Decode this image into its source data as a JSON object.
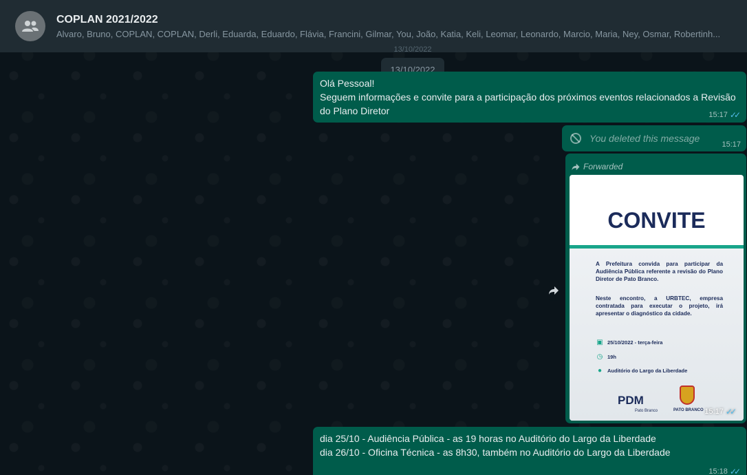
{
  "header": {
    "title": "COPLAN 2021/2022",
    "members": "Alvaro, Bruno, COPLAN, COPLAN, Derli, Eduarda, Eduardo, Flávia, Francini, Gilmar, You, João, Katia, Keli, Leomar, Leonardo, Marcio, Maria, Ney, Osmar, Robertinh..."
  },
  "date_ghost": "13/10/2022",
  "date_chip": "13/10/2022",
  "messages": {
    "m1": {
      "line1": "Olá Pessoal!",
      "line2": "Seguem informações e convite para a participação dos próximos eventos relacionados a Revisão do Plano Diretor",
      "time": "15:17"
    },
    "m2": {
      "text": "You deleted this message",
      "time": "15:17"
    },
    "m3": {
      "forwarded": "Forwarded",
      "time": "15:17",
      "invite": {
        "title": "CONVITE",
        "p1": "A Prefeitura convida para participar da Audiência Pública referente a revisão do Plano Diretor de Pato Branco.",
        "p2": "Neste encontro, a URBTEC, empresa contratada para executar o projeto, irá apresentar o diagnóstico da cidade.",
        "date": "25/10/2022 - terça-feira",
        "hour": "19h",
        "place": "Auditório do Largo da Liberdade",
        "pdm": "PDM",
        "pdm_sub": "Pato Branco",
        "city": "PATO BRANCO"
      }
    },
    "m4": {
      "line1": "dia 25/10 - Audiência Pública - as 19 horas no Auditório do Largo da Liberdade",
      "line2": "dia 26/10 - Oficina Técnica - as 8h30, também no Auditório do Largo da Liberdade",
      "time": "15:18"
    }
  },
  "colors": {
    "header_bg": "#202c33",
    "chat_bg": "#0b141a",
    "outgoing_bubble": "#005c4b",
    "read_ticks": "#53bdeb",
    "invite_accent": "#18a58a",
    "invite_navy": "#1b2b5a"
  },
  "icons": {
    "avatar": "group-icon",
    "deleted": "blocked-icon",
    "forwarded": "forward-arrow-icon",
    "ticks": "double-check-icon",
    "share": "share-forward-icon"
  }
}
